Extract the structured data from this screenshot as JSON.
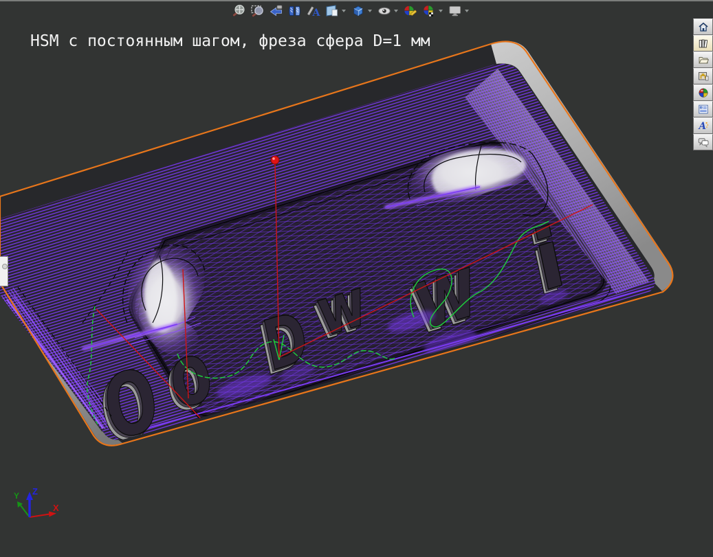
{
  "window": {
    "background": "#323433",
    "top_border": "#7b7d7b"
  },
  "viewport_label": {
    "text": "HSM с постоянным шагом, фреза сфера D=1 мм",
    "color": "#F2F2F2"
  },
  "toolbar": {
    "items": [
      {
        "name": "zoom-extents",
        "dropdown": false
      },
      {
        "name": "zoom-window",
        "dropdown": false
      },
      {
        "name": "previous-view",
        "dropdown": false
      },
      {
        "name": "split-view",
        "dropdown": false
      },
      {
        "name": "annotations-text",
        "dropdown": false
      },
      {
        "name": "view-plane",
        "dropdown": true
      },
      {
        "name": "view-3d-box",
        "dropdown": true
      },
      {
        "name": "visibility-eye",
        "dropdown": true
      },
      {
        "name": "render-edit-sphere",
        "dropdown": false
      },
      {
        "name": "render-quality-sphere",
        "dropdown": true
      },
      {
        "name": "display-monitor",
        "dropdown": true
      }
    ]
  },
  "sidebar": {
    "items": [
      {
        "name": "home",
        "active": false
      },
      {
        "name": "library-books",
        "active": true
      },
      {
        "name": "open-folder",
        "active": false
      },
      {
        "name": "machine-window",
        "active": false
      },
      {
        "name": "color-sphere",
        "active": false
      },
      {
        "name": "properties-form",
        "active": false
      },
      {
        "name": "text-a",
        "active": false
      },
      {
        "name": "comments",
        "active": false
      }
    ]
  },
  "axis_triad": {
    "x": "X",
    "y": "Y",
    "z": "Z",
    "x_color": "#d01616",
    "y_color": "#18a818",
    "z_color": "#2424e0"
  },
  "model": {
    "embossed_letters": [
      {
        "char": "O"
      },
      {
        "char": "o"
      },
      {
        "char": "D"
      },
      {
        "char": "w"
      },
      {
        "char": "w"
      },
      {
        "char": "i"
      }
    ],
    "colors": {
      "stock_outline": "#E8761B",
      "toolpath": "#7A3BF2",
      "rapid_moves": "#D01414",
      "link_moves": "#1ED23E",
      "side_walls": "#ABABAB"
    }
  },
  "tool_marker": {
    "shape": "sphere",
    "color": "#E01414"
  }
}
